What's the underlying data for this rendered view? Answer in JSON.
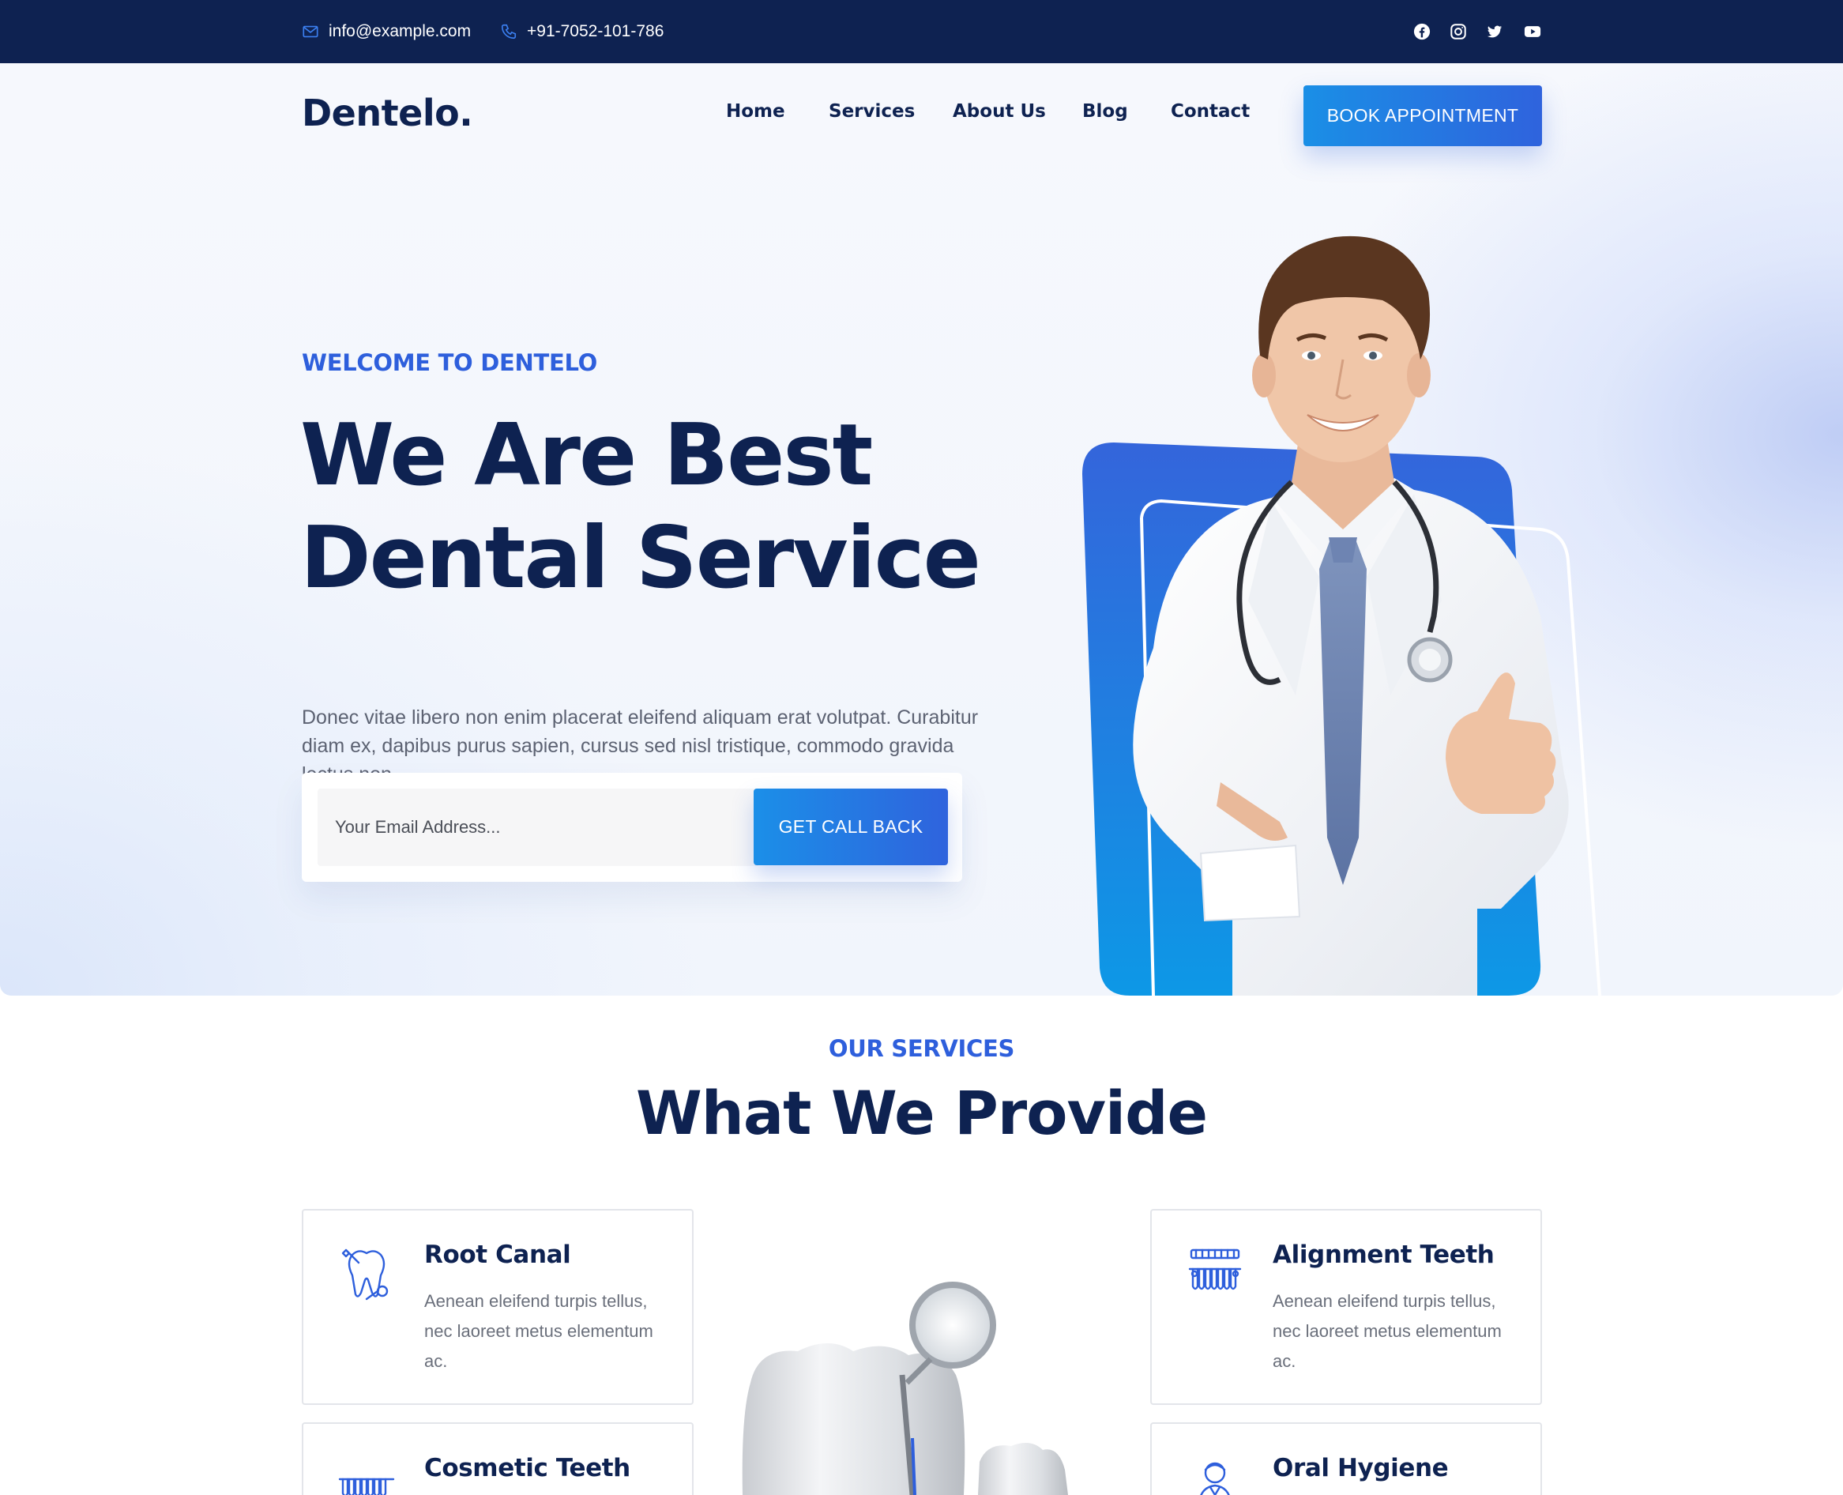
{
  "topbar": {
    "email": "info@example.com",
    "phone": "+91-7052-101-786",
    "social_icons": [
      "facebook-icon",
      "instagram-icon",
      "twitter-icon",
      "youtube-icon"
    ]
  },
  "header": {
    "logo": "Dentelo.",
    "nav": [
      "Home",
      "Services",
      "About Us",
      "Blog",
      "Contact"
    ],
    "cta": "BOOK APPOINTMENT"
  },
  "hero": {
    "eyebrow": "WELCOME TO DENTELO",
    "title_line1": "We Are Best",
    "title_line2": "Dental Service",
    "description": "Donec vitae libero non enim placerat eleifend aliquam erat volutpat. Curabitur diam ex, dapibus purus sapien, cursus sed nisl tristique, commodo gravida lectus non.",
    "email_placeholder": "Your Email Address...",
    "callback_button": "GET CALL BACK"
  },
  "services": {
    "eyebrow": "OUR SERVICES",
    "title": "What We Provide",
    "items": [
      {
        "title": "Root Canal",
        "description": "Aenean eleifend turpis tellus, nec laoreet metus elementum ac.",
        "icon": "root-canal-icon"
      },
      {
        "title": "Alignment Teeth",
        "description": "Aenean eleifend turpis tellus, nec laoreet metus elementum ac.",
        "icon": "alignment-teeth-icon"
      },
      {
        "title": "Cosmetic Teeth",
        "icon": "cosmetic-teeth-icon"
      },
      {
        "title": "Oral Hygiene",
        "icon": "oral-hygiene-icon"
      }
    ]
  },
  "colors": {
    "navy": "#0e2251",
    "accent_blue": "#2e5fdc",
    "gradient_start": "#1a8fe6",
    "gradient_end": "#2f63dd"
  }
}
